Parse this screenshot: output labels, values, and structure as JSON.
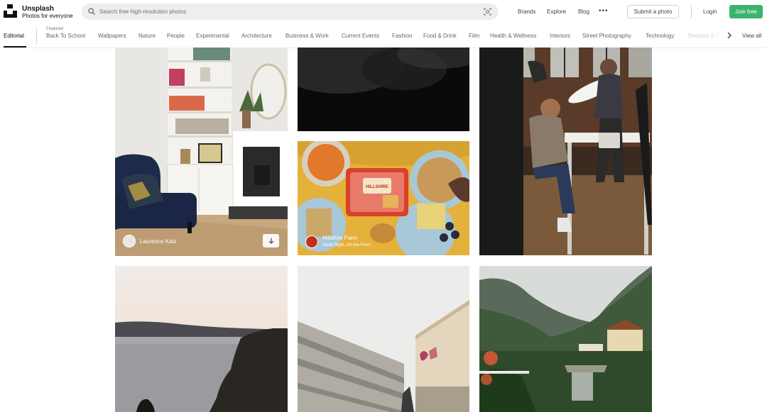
{
  "header": {
    "brand_name": "Unsplash",
    "brand_tagline": "Photos for everyone",
    "search_placeholder": "Search free high-resolution photos",
    "nav": [
      "Brands",
      "Explore",
      "Blog"
    ],
    "more_label": "•••",
    "submit_label": "Submit a photo",
    "login_label": "Login",
    "join_label": "Join free"
  },
  "topics": {
    "editorial": "Editorial",
    "featured": "Featured",
    "items": [
      "Back To School",
      "Wallpapers",
      "Nature",
      "People",
      "Experimental",
      "Architecture",
      "Business & Work",
      "Current Events",
      "Fashion",
      "Food & Drink",
      "Film",
      "Health & Wellness",
      "Interiors",
      "Street Photography",
      "Technology",
      "Textures & P"
    ],
    "view_all": "View all"
  },
  "photos": {
    "p1": {
      "author": "Laurence Katz"
    },
    "p3": {
      "author": "Hillshire Farm",
      "subtitle": "Made Right, On the Farm"
    }
  },
  "colors": {
    "join": "#3cb46e",
    "search_bg": "#eeeeee"
  }
}
